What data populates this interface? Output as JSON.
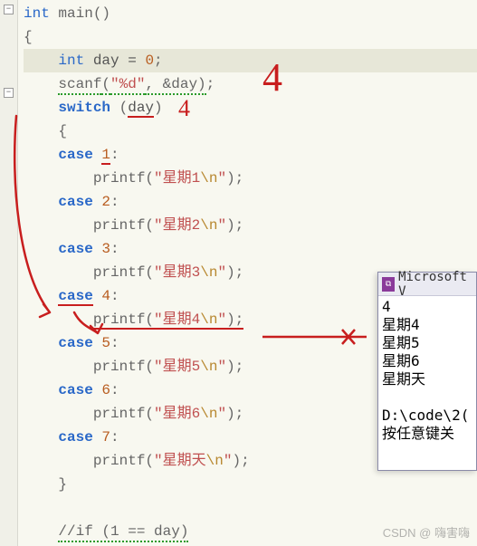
{
  "code": {
    "l1_ty": "int",
    "l1_fn": "main",
    "l1_paren": "()",
    "l2": "{",
    "l3_ind": "    ",
    "l3_ty": "int",
    "l3_id": " day = ",
    "l3_num": "0",
    "l3_semi": ";",
    "l4_ind": "    ",
    "l4_fn": "scanf",
    "l4_open": "(",
    "l4_fmt": "\"%d\"",
    "l4_arg": ", &day)",
    "l4_semi": ";",
    "l5_ind": "    ",
    "l5_kw": "switch",
    "l5_open": " (",
    "l5_id": "day",
    "l5_close": ")",
    "l6_ind": "    ",
    "l6": "{",
    "c1_ind": "    ",
    "c1_kw": "case",
    "c1_sp": " ",
    "c1_num": "1",
    "c1_col": ":",
    "p1_ind": "        ",
    "p1_fn": "printf",
    "p1_open": "(",
    "p1_q1": "\"",
    "p1_txt": "星期1",
    "p1_esc": "\\n",
    "p1_q2": "\"",
    "p1_close": ");",
    "c2_ind": "    ",
    "c2_kw": "case",
    "c2_sp": " ",
    "c2_num": "2",
    "c2_col": ":",
    "p2_ind": "        ",
    "p2_fn": "printf",
    "p2_open": "(",
    "p2_q1": "\"",
    "p2_txt": "星期2",
    "p2_esc": "\\n",
    "p2_q2": "\"",
    "p2_close": ");",
    "c3_ind": "    ",
    "c3_kw": "case",
    "c3_sp": " ",
    "c3_num": "3",
    "c3_col": ":",
    "p3_ind": "        ",
    "p3_fn": "printf",
    "p3_open": "(",
    "p3_q1": "\"",
    "p3_txt": "星期3",
    "p3_esc": "\\n",
    "p3_q2": "\"",
    "p3_close": ");",
    "c4_ind": "    ",
    "c4_kw": "case",
    "c4_sp": " ",
    "c4_num": "4",
    "c4_col": ":",
    "p4_ind": "        ",
    "p4_fn": "printf",
    "p4_open": "(",
    "p4_q1": "\"",
    "p4_txt": "星期4",
    "p4_esc": "\\n",
    "p4_q2": "\"",
    "p4_close": ");",
    "c5_ind": "    ",
    "c5_kw": "case",
    "c5_sp": " ",
    "c5_num": "5",
    "c5_col": ":",
    "p5_ind": "        ",
    "p5_fn": "printf",
    "p5_open": "(",
    "p5_q1": "\"",
    "p5_txt": "星期5",
    "p5_esc": "\\n",
    "p5_q2": "\"",
    "p5_close": ");",
    "c6_ind": "    ",
    "c6_kw": "case",
    "c6_sp": " ",
    "c6_num": "6",
    "c6_col": ":",
    "p6_ind": "        ",
    "p6_fn": "printf",
    "p6_open": "(",
    "p6_q1": "\"",
    "p6_txt": "星期6",
    "p6_esc": "\\n",
    "p6_q2": "\"",
    "p6_close": ");",
    "c7_ind": "    ",
    "c7_kw": "case",
    "c7_sp": " ",
    "c7_num": "7",
    "c7_col": ":",
    "p7_ind": "        ",
    "p7_fn": "printf",
    "p7_open": "(",
    "p7_q1": "\"",
    "p7_txt": "星期天",
    "p7_esc": "\\n",
    "p7_q2": "\"",
    "p7_close": ");",
    "l21_ind": "    ",
    "l21": "}",
    "l23_ind": "    ",
    "l23": "//if (1 == day)"
  },
  "annotations": {
    "four_top": "4",
    "four_small": "4"
  },
  "console": {
    "title": "Microsoft V",
    "input": "4",
    "out1": "星期4",
    "out2": "星期5",
    "out3": "星期6",
    "out4": "星期天",
    "path": "D:\\code\\2(",
    "press": "按任意键关"
  },
  "fold_minus": "−",
  "watermark": "CSDN @   嗨害嗨"
}
